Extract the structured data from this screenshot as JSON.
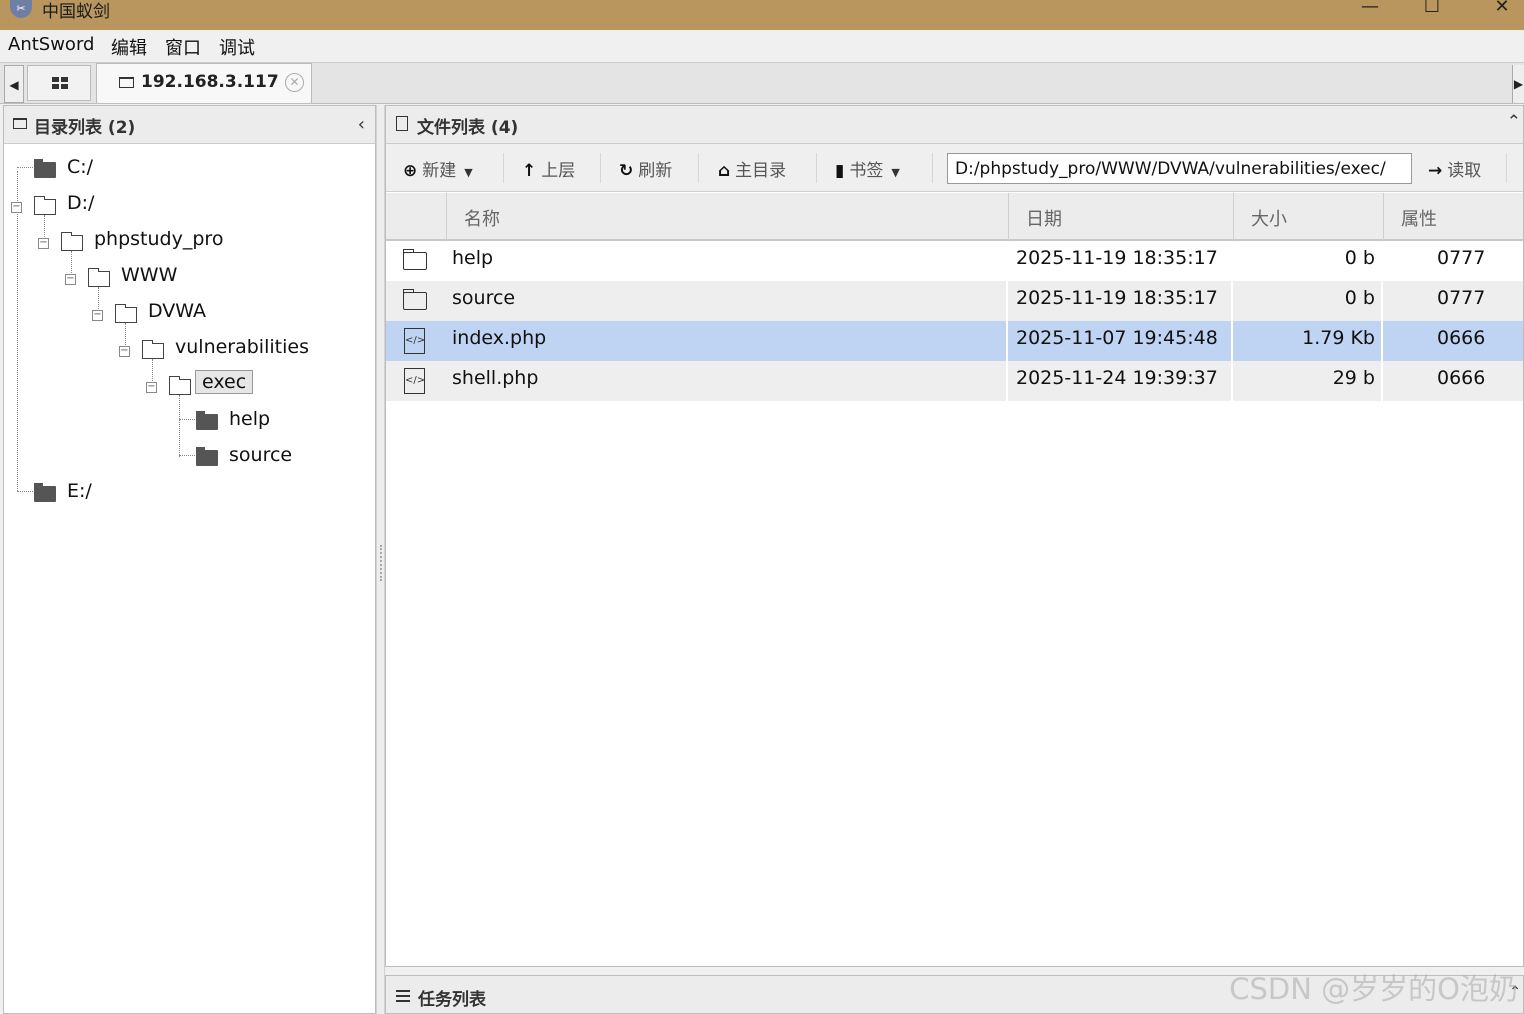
{
  "window": {
    "title": "中国蚁剑",
    "icon": "antsword-logo-icon",
    "controls": [
      "minimize-icon",
      "maximize-icon",
      "close-icon"
    ]
  },
  "menu": [
    "AntSword",
    "编辑",
    "窗口",
    "调试"
  ],
  "tabs": {
    "home_icon": "grid-icon",
    "active": {
      "label": "192.168.3.117",
      "icon": "folder-icon",
      "close_icon": "circle-x-icon"
    }
  },
  "dir_panel": {
    "title": "目录列表 (2)",
    "tree": [
      {
        "label": "C:/",
        "depth": 0,
        "state": "closed"
      },
      {
        "label": "D:/",
        "depth": 0,
        "state": "open"
      },
      {
        "label": "phpstudy_pro",
        "depth": 1,
        "state": "open"
      },
      {
        "label": "WWW",
        "depth": 2,
        "state": "open"
      },
      {
        "label": "DVWA",
        "depth": 3,
        "state": "open"
      },
      {
        "label": "vulnerabilities",
        "depth": 4,
        "state": "open"
      },
      {
        "label": "exec",
        "depth": 5,
        "state": "open",
        "selected": true
      },
      {
        "label": "help",
        "depth": 6,
        "state": "closed"
      },
      {
        "label": "source",
        "depth": 6,
        "state": "closed"
      },
      {
        "label": "E:/",
        "depth": 0,
        "state": "closed"
      }
    ]
  },
  "file_panel": {
    "title": "文件列表 (4)",
    "toolbar": {
      "new_label": "新建",
      "up_label": "上层",
      "refresh_label": "刷新",
      "home_label": "主目录",
      "bookmark_label": "书签",
      "path_value": "D:/phpstudy_pro/WWW/DVWA/vulnerabilities/exec/",
      "read_label": "读取"
    },
    "columns": [
      "名称",
      "日期",
      "大小",
      "属性"
    ],
    "files": [
      {
        "name": "help",
        "date": "2025-11-19 18:35:17",
        "size": "0 b",
        "attr": "0777",
        "type": "folder"
      },
      {
        "name": "source",
        "date": "2025-11-19 18:35:17",
        "size": "0 b",
        "attr": "0777",
        "type": "folder"
      },
      {
        "name": "index.php",
        "date": "2025-11-07 19:45:48",
        "size": "1.79 Kb",
        "attr": "0666",
        "type": "code",
        "selected": true
      },
      {
        "name": "shell.php",
        "date": "2025-11-24 19:39:37",
        "size": "29 b",
        "attr": "0666",
        "type": "code"
      }
    ]
  },
  "task_panel": {
    "title": "任务列表"
  },
  "watermark": "CSDN @岁岁的O泡奶",
  "colors": {
    "titlebar": "#b8965e",
    "selected_row": "#bfd3f3"
  }
}
